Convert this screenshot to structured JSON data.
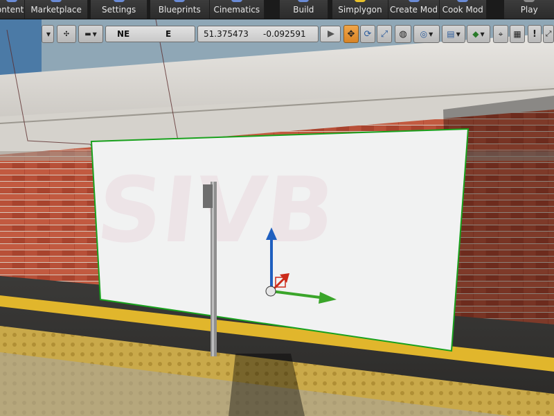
{
  "main_toolbar": {
    "items": [
      {
        "label": "Content"
      },
      {
        "label": "Marketplace"
      },
      {
        "label": "Settings"
      },
      {
        "label": "Blueprints"
      },
      {
        "label": "Cinematics"
      },
      {
        "label": "Build"
      },
      {
        "label": "Simplygon"
      },
      {
        "label": "Create Mod"
      },
      {
        "label": "Cook Mod"
      },
      {
        "label": "Play"
      }
    ]
  },
  "viewport_toolbar": {
    "compass_left": "NE",
    "compass_right": "E",
    "coord_x": "51.375473",
    "coord_y": "-0.092591",
    "icons": [
      "viewport-options-icon",
      "camera-speed-icon",
      "view-mode-icon",
      "translate-icon",
      "rotate-icon",
      "scale-icon",
      "world-space-icon",
      "surface-snap-icon",
      "grid-snap-icon",
      "layout-icon",
      "grid-icon",
      "exclamation-icon",
      "maximize-icon"
    ]
  },
  "colors": {
    "toolbar_bg": "#2f2f2f",
    "active_tool": "#e8962e",
    "gizmo_z": "#1f5fbf",
    "gizmo_x": "#cc2a1a",
    "gizmo_y": "#3aa52a",
    "selection_outline": "#19a11d"
  }
}
